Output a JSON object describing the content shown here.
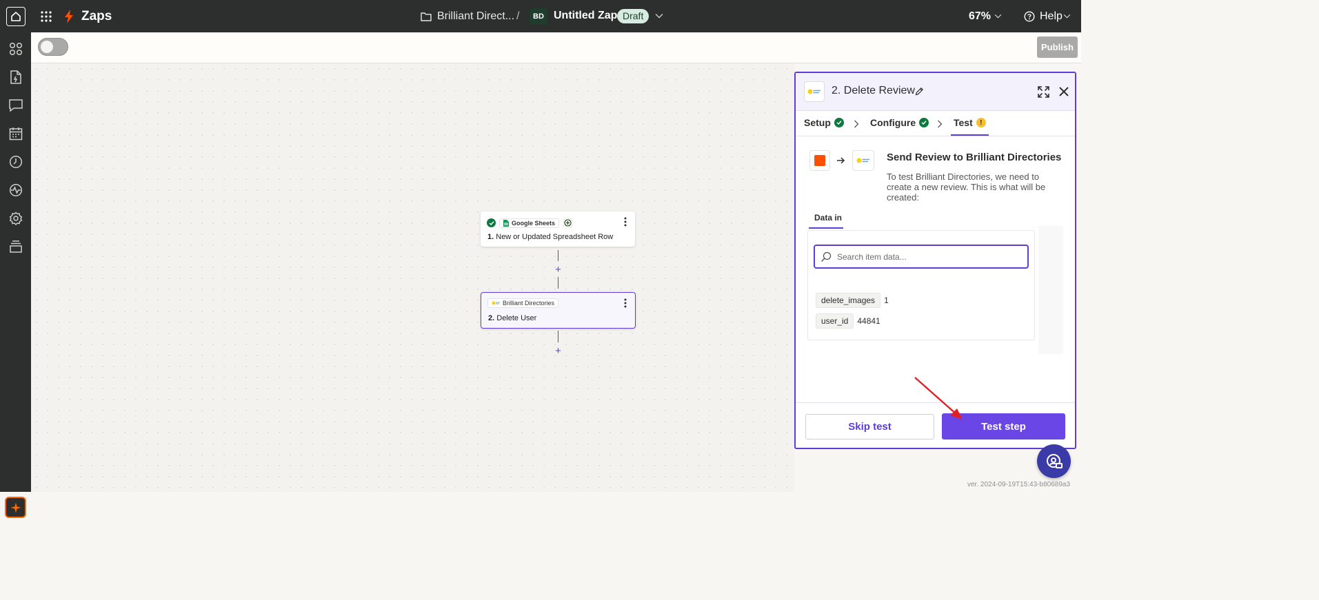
{
  "header": {
    "app_name": "Zaps",
    "folder_name": "Brilliant Direct...",
    "separator": "/",
    "app_avatar": "BD",
    "zap_name": "Untitled Zap",
    "status_badge": "Draft",
    "zoom": "67%",
    "help_label": "Help"
  },
  "toolbar": {
    "publish_label": "Publish"
  },
  "canvas": {
    "nodes": [
      {
        "app": "Google Sheets",
        "number": "1.",
        "title": "New or Updated Spreadsheet Row"
      },
      {
        "app": "Brilliant Directories",
        "number": "2.",
        "title": "Delete User"
      }
    ],
    "add_step": "+"
  },
  "panel": {
    "title": "2. Delete Review",
    "tabs": [
      {
        "label": "Setup"
      },
      {
        "label": "Configure"
      },
      {
        "label": "Test",
        "status": "!"
      }
    ],
    "test_title": "Send Review to Brilliant Directories",
    "test_description": "To test Brilliant Directories, we need to create a new review. This is what will be created:",
    "data_tab": "Data in",
    "search_placeholder": "Search item data...",
    "fields": [
      {
        "key": "delete_images",
        "value": "1"
      },
      {
        "key": "user_id",
        "value": "44841"
      }
    ],
    "skip_label": "Skip test",
    "test_label": "Test step"
  },
  "footer": {
    "version": "ver. 2024-09-19T15:43-b80689a3"
  },
  "colors": {
    "accent": "#5e3cdb",
    "brand_orange": "#ff4f00",
    "success": "#0c7a3f",
    "warning": "#fbbe2f",
    "dark_chrome": "#2d2e2e"
  },
  "icons": [
    "home-icon",
    "apps-grid-icon",
    "zap-logo-icon",
    "folder-icon",
    "chevron-down-icon",
    "help-icon",
    "zap-templates-icon",
    "file-icon",
    "chat-icon",
    "calendar-icon",
    "history-icon",
    "activity-icon",
    "settings-icon",
    "layers-icon",
    "ai-sparkle-icon",
    "pencil-icon",
    "expand-icon",
    "close-icon",
    "check-icon",
    "warning-icon",
    "arrow-right-icon",
    "search-icon",
    "kebab-menu-icon",
    "support-chat-icon"
  ]
}
